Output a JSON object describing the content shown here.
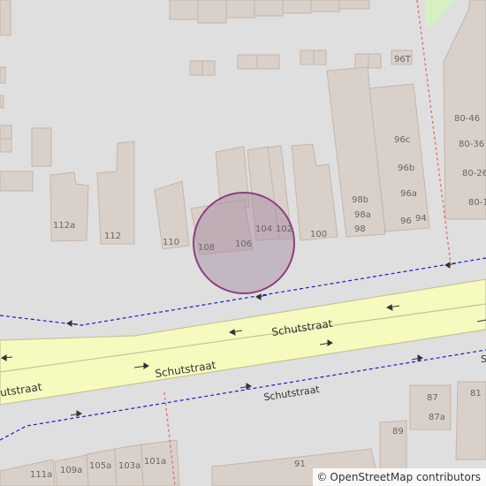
{
  "map": {
    "background": "#e0dfdf",
    "building_fill": "#d9d0c9",
    "building_stroke": "#c4b6ab",
    "road_fill": "#f7fabf",
    "road_casing": "#c4c49b",
    "marker_fill": "#9c7a9c",
    "marker_stroke": "#8b3f7d",
    "bus_route_color": "#1a1ad1",
    "boundary_color": "#e07878",
    "park_color": "#d6f0c2"
  },
  "streets": {
    "schutstraat_upper": "Schutstraat",
    "schutstraat_lower": "Schutstraat",
    "schutstraat_left": "Schutstraat",
    "schutstraat_path": "Schutstraat",
    "schutstraat_right_edge": "S"
  },
  "house_numbers": {
    "n96T": "96T",
    "n80_46": "80-46",
    "n80_36": "80-36",
    "n80_26": "80-26",
    "n80_1": "80-1",
    "n96c": "96c",
    "n96b": "96b",
    "n96a": "96a",
    "n96": "96",
    "n94": "94",
    "n98b": "98b",
    "n98a": "98a",
    "n98": "98",
    "n100": "100",
    "n102": "102",
    "n104": "104",
    "n106": "106",
    "n108": "108",
    "n110": "110",
    "n112": "112",
    "n112a": "112a",
    "n87": "87",
    "n81": "81",
    "n87a": "87a",
    "n89": "89",
    "n91": "91",
    "n111a": "111a",
    "n109a": "109a",
    "n105a": "105a",
    "n103a": "103a",
    "n101a": "101a"
  },
  "attribution": {
    "symbol": "©",
    "text": "OpenStreetMap contributors"
  }
}
